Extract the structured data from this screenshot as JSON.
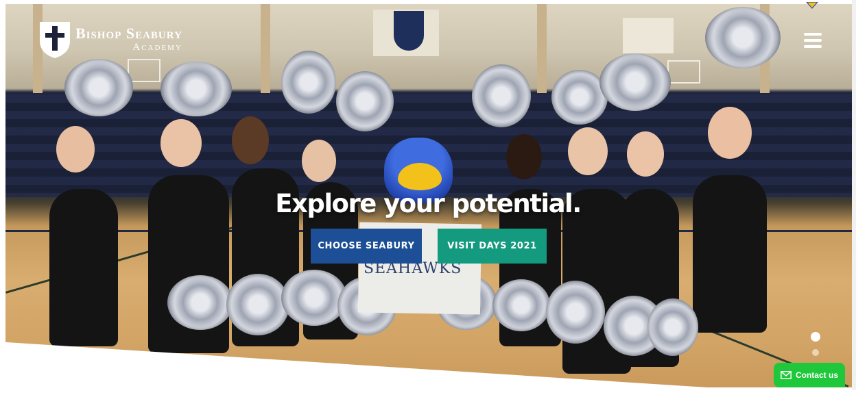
{
  "site": {
    "logo": {
      "line1": "Bishop Seabury",
      "line2": "Academy",
      "icon": "cross-crest-icon"
    },
    "menu_icon": "hamburger-menu-icon"
  },
  "hero": {
    "headline": "Explore your potential.",
    "buttons": {
      "choose": "CHOOSE SEABURY",
      "visit": "VISIT DAYS 2021"
    },
    "sign_text": "SEAHAWKS",
    "slider": {
      "dots": 2,
      "active": 1
    }
  },
  "contact": {
    "label": "Contact us",
    "icon": "envelope-icon"
  },
  "colors": {
    "choose": "#1c4f95",
    "visit": "#149a7e",
    "contact": "#1ec83a"
  }
}
